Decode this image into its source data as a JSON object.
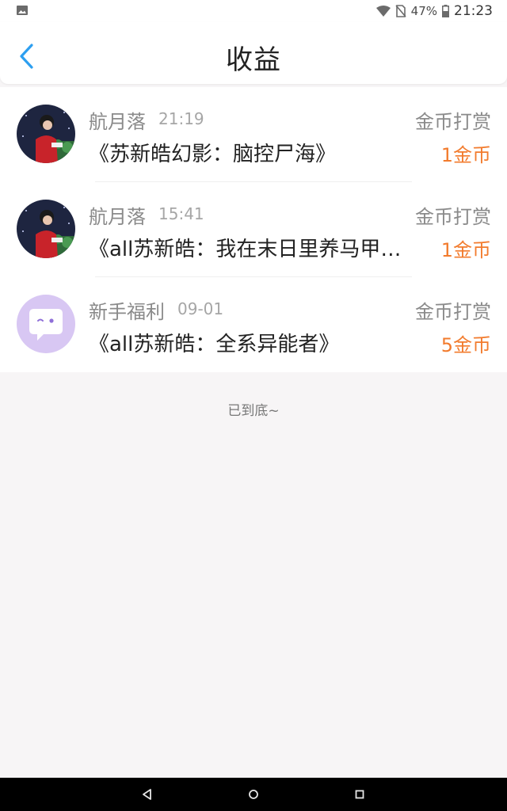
{
  "status_bar": {
    "battery": "47%",
    "time": "21:23",
    "icons": [
      "image-icon",
      "wifi-icon",
      "no-sim-icon",
      "battery-icon"
    ]
  },
  "header": {
    "title": "收益",
    "back_icon": "chevron-left-icon"
  },
  "colors": {
    "accent_blue": "#2d9ff0",
    "amount_orange": "#f27b2d"
  },
  "items": [
    {
      "name": "航月落",
      "time": "21:19",
      "book": "《苏新皓幻影：脑控尸海》",
      "type": "金币打赏",
      "amount": "1金币",
      "avatar": "user-photo-avatar"
    },
    {
      "name": "航月落",
      "time": "15:41",
      "book": "《all苏新皓：我在末日里养马甲…",
      "type": "金币打赏",
      "amount": "1金币",
      "avatar": "user-photo-avatar"
    },
    {
      "name": "新手福利",
      "time": "09-01",
      "book": "《all苏新皓：全系异能者》",
      "type": "金币打赏",
      "amount": "5金币",
      "avatar": "chat-bubble-avatar"
    }
  ],
  "footer": {
    "end_text": "已到底~"
  },
  "nav_bar": {
    "buttons": [
      "back-triangle-icon",
      "home-circle-icon",
      "recents-square-icon"
    ]
  }
}
